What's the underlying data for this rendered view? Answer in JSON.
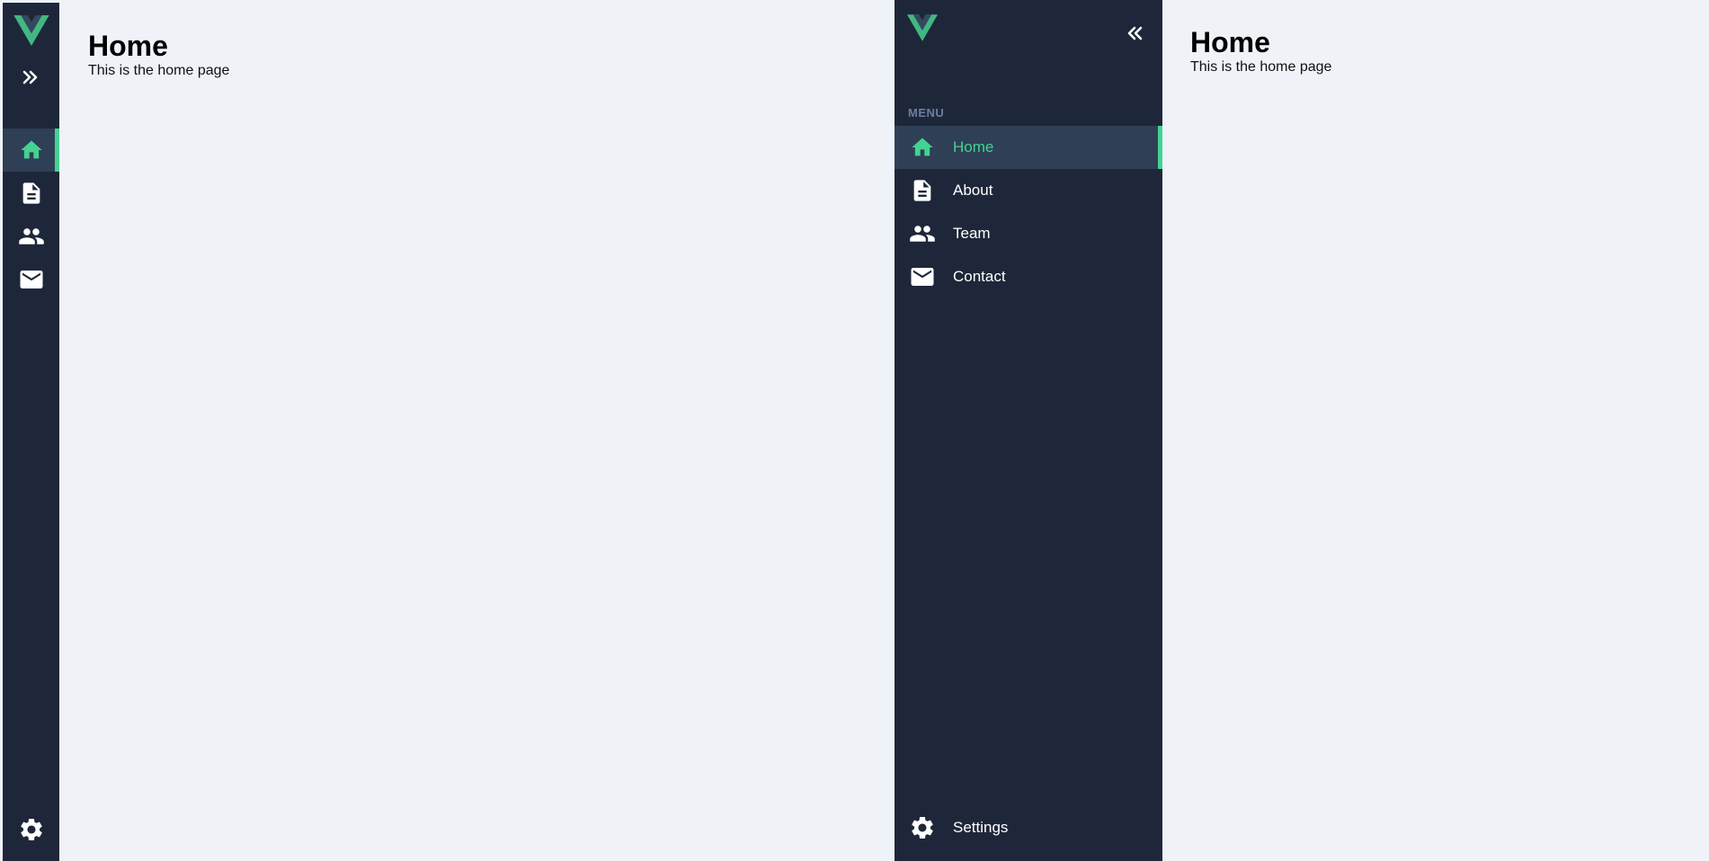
{
  "colors": {
    "sidebar_bg": "#1e273a",
    "active_bg": "#2f3f55",
    "accent": "#42d392",
    "page_bg": "#eff3f8",
    "menu_heading": "#6b7ea0"
  },
  "collapsed_view": {
    "toggle_icon": "chevrons-right-icon",
    "nav_items": [
      {
        "icon": "home-icon",
        "active": true
      },
      {
        "icon": "document-icon",
        "active": false
      },
      {
        "icon": "people-icon",
        "active": false
      },
      {
        "icon": "mail-icon",
        "active": false
      }
    ],
    "settings_icon": "gear-icon",
    "main": {
      "title": "Home",
      "subtitle": "This is the home page"
    }
  },
  "expanded_view": {
    "toggle_icon": "chevrons-left-icon",
    "menu_heading": "MENU",
    "nav_items": [
      {
        "label": "Home",
        "icon": "home-icon",
        "active": true
      },
      {
        "label": "About",
        "icon": "document-icon",
        "active": false
      },
      {
        "label": "Team",
        "icon": "people-icon",
        "active": false
      },
      {
        "label": "Contact",
        "icon": "mail-icon",
        "active": false
      }
    ],
    "settings_label": "Settings",
    "settings_icon": "gear-icon",
    "main": {
      "title": "Home",
      "subtitle": "This is the home page"
    }
  }
}
